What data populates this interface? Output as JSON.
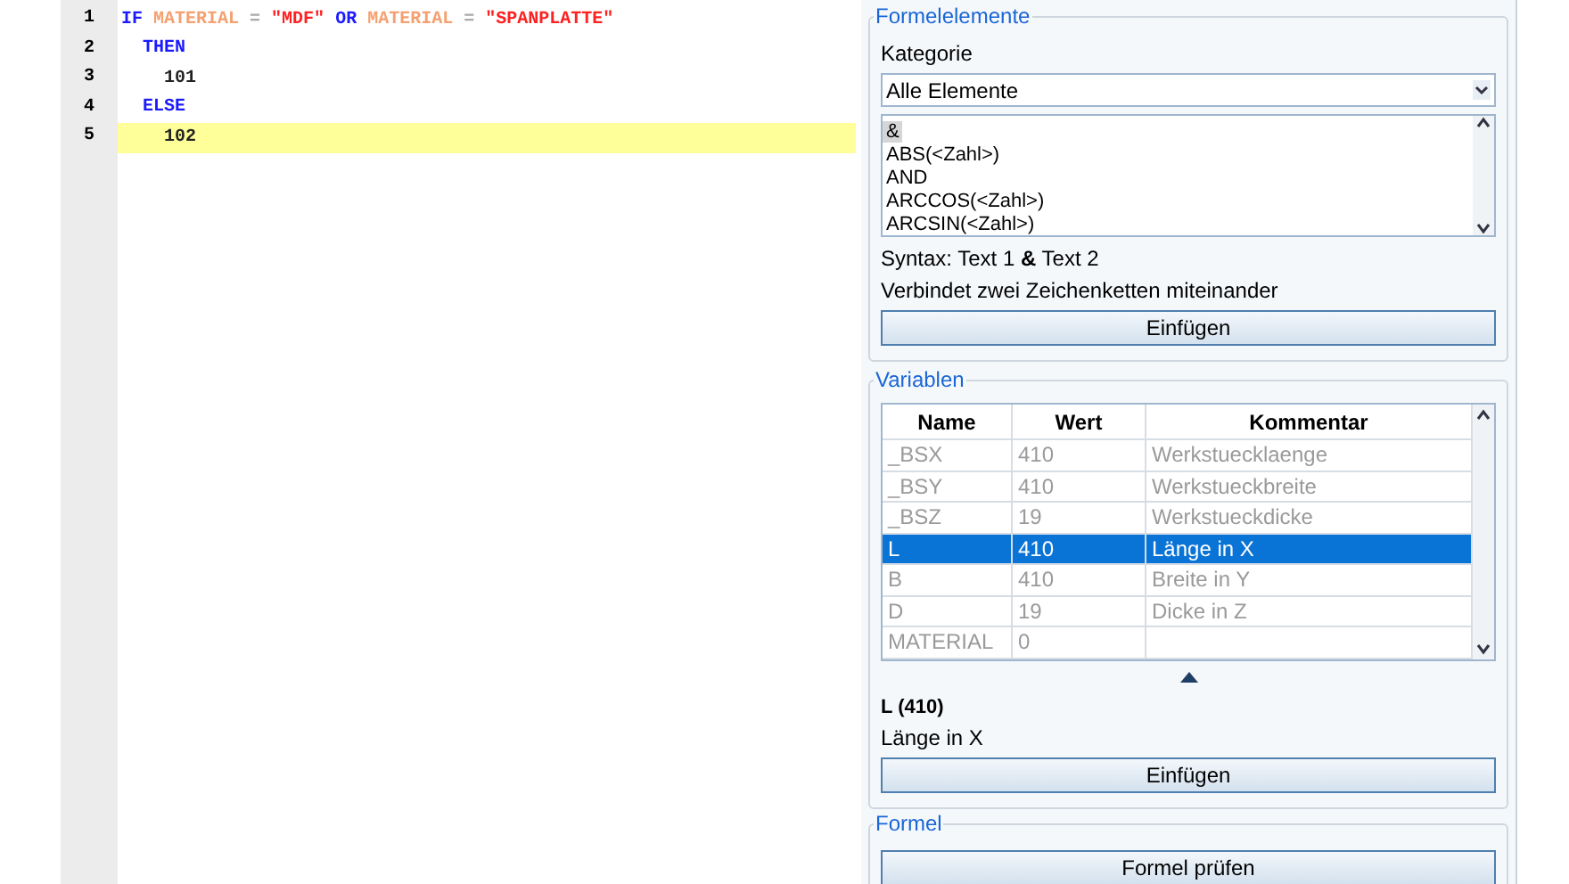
{
  "editor": {
    "lines": [
      {
        "number": "1",
        "highlighted": false,
        "tokens": [
          {
            "kind": "keyword",
            "text": "IF"
          },
          {
            "kind": "ident",
            "text": "MATERIAL"
          },
          {
            "kind": "op",
            "text": "="
          },
          {
            "kind": "string",
            "text": "\"MDF\""
          },
          {
            "kind": "keyword",
            "text": "OR"
          },
          {
            "kind": "ident",
            "text": "MATERIAL"
          },
          {
            "kind": "op",
            "text": "="
          },
          {
            "kind": "string",
            "text": "\"SPANPLATTE\""
          }
        ],
        "children": [
          {
            "number": "2",
            "highlighted": false,
            "tokens": [
              {
                "kind": "keyword",
                "text": "THEN"
              }
            ],
            "children": [
              {
                "number": "3",
                "highlighted": false,
                "tokens": [
                  {
                    "kind": "number",
                    "text": "101"
                  }
                ]
              }
            ]
          },
          {
            "number": "4",
            "highlighted": false,
            "tokens": [
              {
                "kind": "keyword",
                "text": "ELSE"
              }
            ],
            "children": [
              {
                "number": "5",
                "highlighted": true,
                "tokens": [
                  {
                    "kind": "number",
                    "text": "102"
                  }
                ]
              }
            ]
          }
        ]
      }
    ]
  },
  "formelelemente": {
    "title": "Formelelemente",
    "category_label": "Kategorie",
    "category_value": "Alle Elemente",
    "items": [
      {
        "label": "&",
        "selected": true
      },
      {
        "label": "ABS(<Zahl>)",
        "selected": false
      },
      {
        "label": "AND",
        "selected": false
      },
      {
        "label": "ARCCOS(<Zahl>)",
        "selected": false
      },
      {
        "label": "ARCSIN(<Zahl>)",
        "selected": false
      }
    ],
    "syntax": "Syntax: Text 1 **&** Text 2",
    "description": "Verbindet zwei Zeichenketten miteinander",
    "button": "Einfügen"
  },
  "variablen": {
    "title": "Variablen",
    "columns": [
      "Name",
      "Wert",
      "Kommentar"
    ],
    "rows": [
      {
        "cells": [
          "_BSX",
          "410",
          "Werkstuecklaenge"
        ],
        "selected": false
      },
      {
        "cells": [
          "_BSY",
          "410",
          "Werkstueckbreite"
        ],
        "selected": false
      },
      {
        "cells": [
          "_BSZ",
          "19",
          "Werkstueckdicke"
        ],
        "selected": false
      },
      {
        "cells": [
          "L",
          "410",
          "Länge in X"
        ],
        "selected": true
      },
      {
        "cells": [
          "B",
          "410",
          "Breite in Y"
        ],
        "selected": false
      },
      {
        "cells": [
          "D",
          "19",
          "Dicke in Z"
        ],
        "selected": false
      },
      {
        "cells": [
          "MATERIAL",
          "0",
          ""
        ],
        "selected": false
      }
    ],
    "detail_title": "L (410)",
    "detail_text": "Länge in X",
    "button": "Einfügen"
  },
  "formel": {
    "title": "Formel",
    "button": "Formel prüfen"
  }
}
